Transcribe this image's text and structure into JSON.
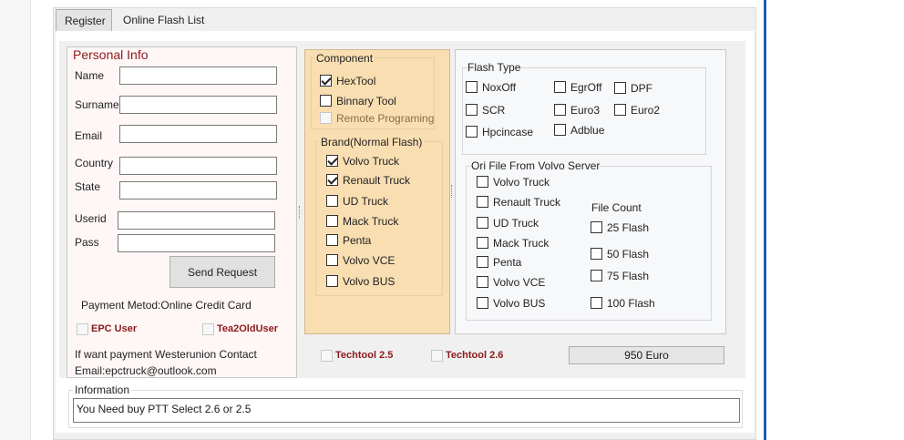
{
  "tabs": [
    {
      "label": "Register",
      "active": true
    },
    {
      "label": "Online Flash List",
      "active": false
    }
  ],
  "personal": {
    "title": "Personal Info",
    "fields": {
      "name": {
        "label": "Name",
        "value": ""
      },
      "surname": {
        "label": "Surname",
        "value": ""
      },
      "email": {
        "label": "Email",
        "value": ""
      },
      "country": {
        "label": "Country",
        "value": ""
      },
      "state": {
        "label": "State",
        "value": ""
      },
      "userid": {
        "label": "Userid",
        "value": ""
      },
      "pass": {
        "label": "Pass",
        "value": ""
      }
    },
    "send_label": "Send Request",
    "payment_method": "Payment Metod:Online Credit Card",
    "epc_user": "EPC User",
    "tea2_old_user": "Tea2OldUser",
    "western_line1": "If want payment Westerunion Contact",
    "western_line2": "Email:epctruck@outlook.com"
  },
  "component": {
    "title": "Component",
    "items": [
      {
        "label": "HexTool",
        "checked": true,
        "disabled": false
      },
      {
        "label": "Binnary Tool",
        "checked": false,
        "disabled": false
      },
      {
        "label": "Remote Programing",
        "checked": false,
        "disabled": true
      }
    ]
  },
  "brand": {
    "title": "Brand(Normal Flash)",
    "items": [
      {
        "label": "Volvo Truck",
        "checked": true
      },
      {
        "label": "Renault Truck",
        "checked": true
      },
      {
        "label": "UD Truck",
        "checked": false
      },
      {
        "label": "Mack Truck",
        "checked": false
      },
      {
        "label": "Penta",
        "checked": false
      },
      {
        "label": "Volvo VCE",
        "checked": false
      },
      {
        "label": "Volvo BUS",
        "checked": false
      }
    ]
  },
  "flash_type": {
    "title": "Flash Type",
    "items": [
      {
        "label": "NoxOff",
        "checked": false
      },
      {
        "label": "EgrOff",
        "checked": false
      },
      {
        "label": "DPF",
        "checked": false
      },
      {
        "label": "SCR",
        "checked": false
      },
      {
        "label": "Euro3",
        "checked": false
      },
      {
        "label": "Euro2",
        "checked": false
      },
      {
        "label": "Hpcincase",
        "checked": false
      },
      {
        "label": "Adblue",
        "checked": false
      }
    ]
  },
  "ori_file": {
    "title": "Ori File From Volvo Server",
    "items": [
      {
        "label": "Volvo Truck",
        "checked": false
      },
      {
        "label": "Renault Truck",
        "checked": false
      },
      {
        "label": "UD Truck",
        "checked": false
      },
      {
        "label": "Mack Truck",
        "checked": false
      },
      {
        "label": "Penta",
        "checked": false
      },
      {
        "label": "Volvo VCE",
        "checked": false
      },
      {
        "label": "Volvo BUS",
        "checked": false
      }
    ],
    "file_count_title": "File Count",
    "file_counts": [
      {
        "label": "25 Flash",
        "checked": false
      },
      {
        "label": "50 Flash",
        "checked": false
      },
      {
        "label": "75 Flash",
        "checked": false
      },
      {
        "label": "100 Flash",
        "checked": false
      }
    ]
  },
  "techtool": {
    "t25": "Techtool 2.5",
    "t26": "Techtool 2.6"
  },
  "price": "950 Euro",
  "information": {
    "title": "Information",
    "text": "You Need buy PTT Select 2.6 or 2.5"
  },
  "colors": {
    "component_bg": "#f8deb1",
    "personal_title": "#8b1a1a",
    "accent_red": "#8b1a1a"
  }
}
